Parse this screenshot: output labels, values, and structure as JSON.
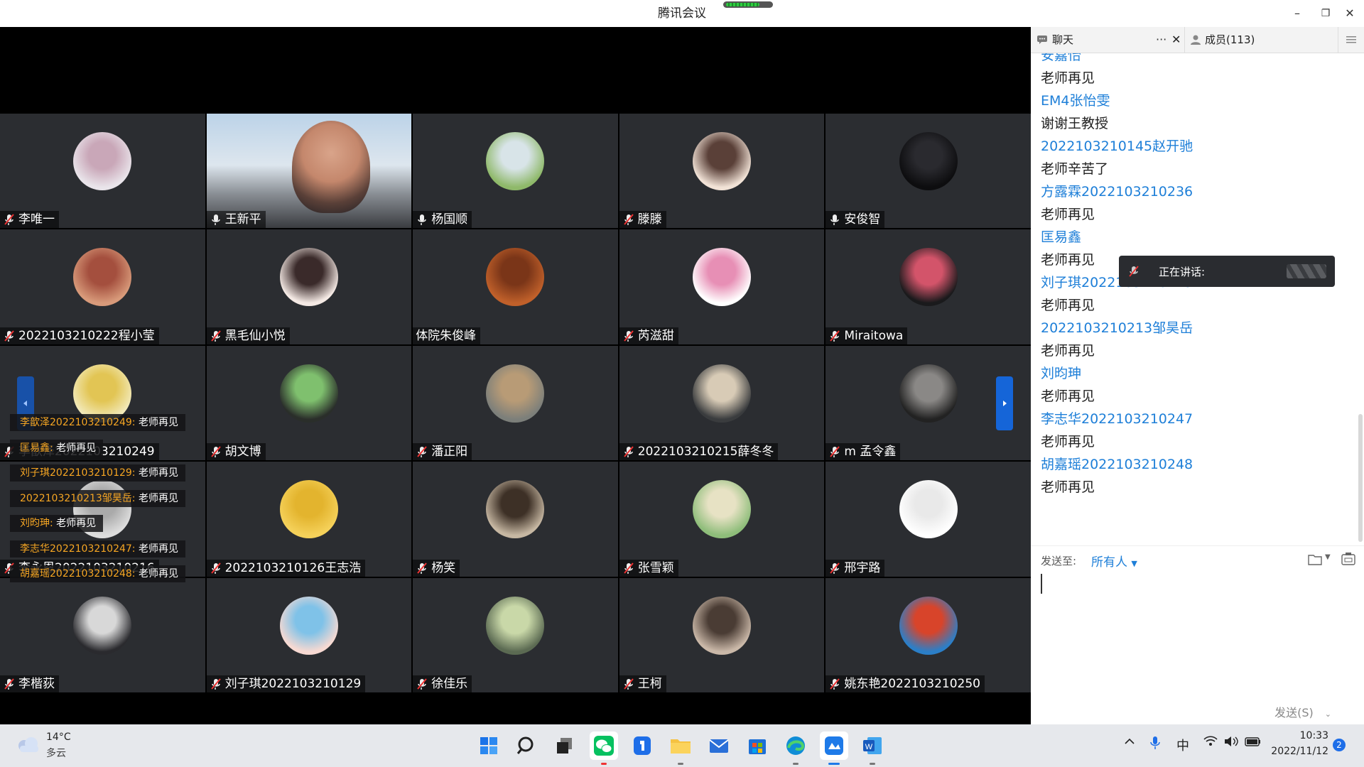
{
  "window": {
    "title": "腾讯会议",
    "signal_level": 0.75,
    "controls": {
      "minimize": "–",
      "restore": "❐",
      "close": "✕"
    }
  },
  "participants": [
    {
      "name": "李唯一",
      "muted": true,
      "avatar": [
        "#e9e4ea",
        "#c9a7b8"
      ]
    },
    {
      "name": "王新平",
      "muted": false,
      "video": true
    },
    {
      "name": "杨国顺",
      "muted": false,
      "avatar": [
        "#8fb96a",
        "#d8e4e8"
      ]
    },
    {
      "name": "滕滕",
      "muted": true,
      "avatar": [
        "#f1e2d6",
        "#5a4038"
      ]
    },
    {
      "name": "安俊智",
      "muted": false,
      "avatar": [
        "#0d0d0f",
        "#2a2a2f"
      ]
    },
    {
      "name": "2022103210222程小莹",
      "muted": true,
      "avatar": [
        "#d89a7a",
        "#a44f3e"
      ]
    },
    {
      "name": "黑毛仙小悦",
      "muted": true,
      "avatar": [
        "#f4e9e4",
        "#3a2a2a"
      ]
    },
    {
      "name": "体院朱俊峰",
      "muted": false,
      "hide_mic": true,
      "avatar": [
        "#c0602a",
        "#7a3518"
      ]
    },
    {
      "name": "芮滋甜",
      "muted": true,
      "avatar": [
        "#ffffff",
        "#e78fb5"
      ]
    },
    {
      "name": "Miraitowa",
      "muted": true,
      "avatar": [
        "#1a1a1c",
        "#d3546a"
      ]
    },
    {
      "name": "李歆泽2022103210249",
      "muted": true,
      "avatar": [
        "#f2e9b8",
        "#e2c554"
      ]
    },
    {
      "name": "胡文博",
      "muted": true,
      "avatar": [
        "#2a2e2a",
        "#7fc06e"
      ]
    },
    {
      "name": "潘正阳",
      "muted": true,
      "avatar": [
        "#7c7f7a",
        "#b89b76"
      ]
    },
    {
      "name": "2022103210215薛冬冬",
      "muted": true,
      "avatar": [
        "#3a3c3e",
        "#d8cbb6"
      ]
    },
    {
      "name": "m 孟令鑫",
      "muted": true,
      "avatar": [
        "#222",
        "#8a8886"
      ]
    },
    {
      "name": "李永恩2022103210216",
      "muted": true,
      "avatar": [
        "#ddd",
        "#aaa"
      ]
    },
    {
      "name": "2022103210126王志浩",
      "muted": true,
      "avatar": [
        "#f5d15a",
        "#e3b42e"
      ]
    },
    {
      "name": "杨笑",
      "muted": true,
      "avatar": [
        "#c6b7a2",
        "#3d3026"
      ]
    },
    {
      "name": "张雪颖",
      "muted": true,
      "avatar": [
        "#8ebd7a",
        "#e7e2c4"
      ]
    },
    {
      "name": "邢宇路",
      "muted": true,
      "avatar": [
        "#ffffff",
        "#e9e9e9"
      ]
    },
    {
      "name": "李楷荻",
      "muted": true,
      "avatar": [
        "#2a2a2e",
        "#d8d8d8"
      ]
    },
    {
      "name": "刘子琪2022103210129",
      "muted": true,
      "avatar": [
        "#f7d9d2",
        "#7fc2e8"
      ]
    },
    {
      "name": "徐佳乐",
      "muted": true,
      "avatar": [
        "#5b6a52",
        "#c9d8a8"
      ]
    },
    {
      "name": "王柯",
      "muted": true,
      "avatar": [
        "#cab8a8",
        "#4a3c34"
      ]
    },
    {
      "name": "姚东艳2022103210250",
      "muted": true,
      "avatar": [
        "#2b7fc8",
        "#d8442a"
      ]
    }
  ],
  "chat_overlay": [
    {
      "who": "李歆泽2022103210249:",
      "msg": "老师再见"
    },
    {
      "who": "匡易鑫:",
      "msg": "老师再见"
    },
    {
      "who": "刘子琪2022103210129:",
      "msg": "老师再见"
    },
    {
      "who": "2022103210213邹昊岳:",
      "msg": "老师再见"
    },
    {
      "who": "刘昀珅:",
      "msg": "老师再见"
    },
    {
      "who": "李志华2022103210247:",
      "msg": "老师再见"
    },
    {
      "who": "胡嘉瑶2022103210248:",
      "msg": "老师再见"
    }
  ],
  "panel": {
    "tab_chat": "聊天",
    "tab_more": "···",
    "tab_close": "✕",
    "tab_members": "成员(113)",
    "messages": [
      {
        "type": "sender",
        "text": "安嘉怡"
      },
      {
        "type": "text",
        "text": "老师再见"
      },
      {
        "type": "sender",
        "text": "EM4张怡雯"
      },
      {
        "type": "text",
        "text": "谢谢王教授"
      },
      {
        "type": "sender",
        "text": "2022103210145赵开驰"
      },
      {
        "type": "text",
        "text": "老师辛苦了"
      },
      {
        "type": "sender",
        "text": "方露霖2022103210236"
      },
      {
        "type": "text",
        "text": "老师再见"
      },
      {
        "type": "sender",
        "text": "匡易鑫"
      },
      {
        "type": "text",
        "text": "老师再见"
      },
      {
        "type": "sender",
        "text": "刘子琪2022103210129"
      },
      {
        "type": "text",
        "text": "老师再见"
      },
      {
        "type": "sender",
        "text": "2022103210213邹昊岳"
      },
      {
        "type": "text",
        "text": "老师再见"
      },
      {
        "type": "sender",
        "text": "刘昀珅"
      },
      {
        "type": "text",
        "text": "老师再见"
      },
      {
        "type": "sender",
        "text": "李志华2022103210247"
      },
      {
        "type": "text",
        "text": "老师再见"
      },
      {
        "type": "sender",
        "text": "胡嘉瑶2022103210248"
      },
      {
        "type": "text",
        "text": "老师再见"
      }
    ],
    "speaking_label": "正在讲话:",
    "send_to_label": "发送至:",
    "send_to_value": "所有人",
    "send_button": "发送(S)"
  },
  "taskbar": {
    "weather_temp": "14°C",
    "weather_desc": "多云",
    "ime": "中",
    "time": "10:33",
    "date": "2022/11/12",
    "notifications": "2"
  },
  "colors": {
    "accent": "#1e7fd8",
    "overlay_name": "#f6a623",
    "tile_bg": "#2b2d31"
  }
}
